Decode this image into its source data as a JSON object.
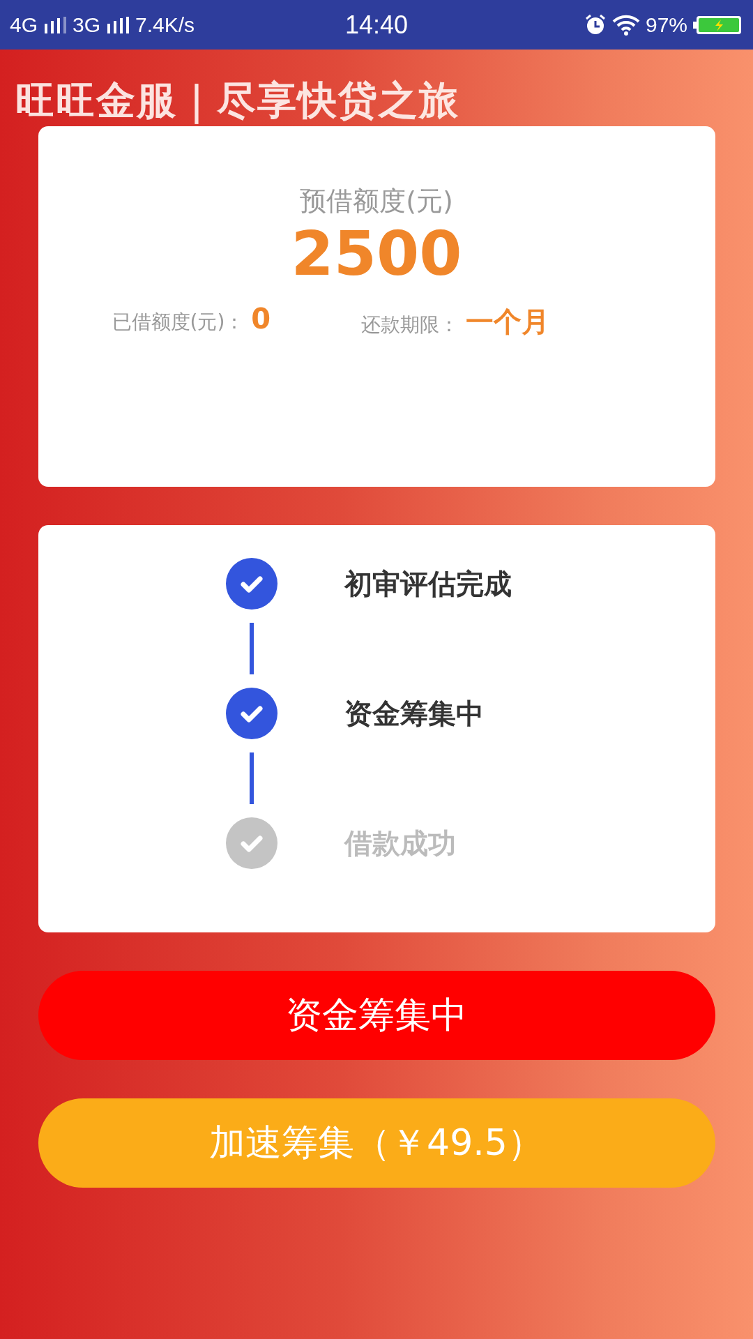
{
  "status_bar": {
    "network_1": "4G",
    "network_2": "3G",
    "speed": "7.4K/s",
    "time": "14:40",
    "battery": "97%"
  },
  "banner": {
    "title": "旺旺金服｜尽享快贷之旅"
  },
  "quota_card": {
    "label": "预借额度(元)",
    "amount": "2500",
    "borrowed_label": "已借额度(元)：",
    "borrowed_value": "0",
    "term_label": "还款期限：",
    "term_value": "一个月"
  },
  "steps": [
    {
      "label": "初审评估完成",
      "done": true
    },
    {
      "label": "资金筹集中",
      "done": true
    },
    {
      "label": "借款成功",
      "done": false
    }
  ],
  "buttons": [
    {
      "label": "资金筹集中",
      "kind": "primary"
    },
    {
      "label": "加速筹集（￥49.5）",
      "kind": "accent"
    }
  ]
}
